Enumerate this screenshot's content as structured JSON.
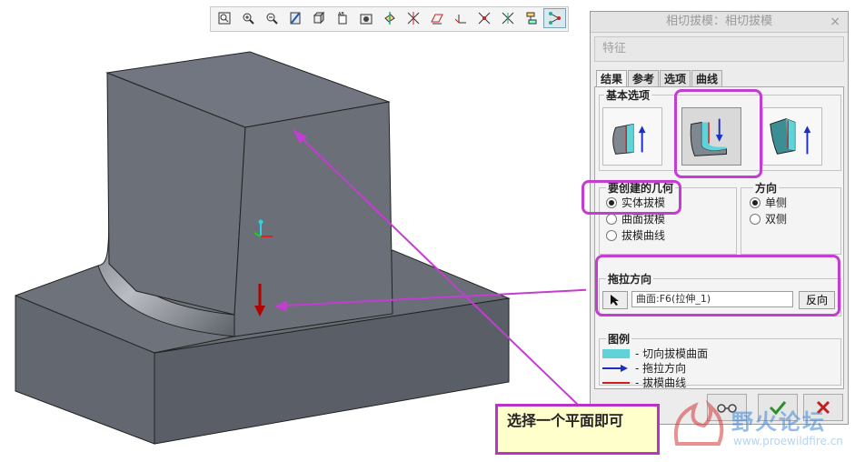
{
  "toolbar": {
    "buttons": [
      {
        "icon": "zoom-refit-icon"
      },
      {
        "icon": "zoom-in-icon"
      },
      {
        "icon": "zoom-out-icon"
      },
      {
        "icon": "repaint-icon"
      },
      {
        "icon": "orientation-icon"
      },
      {
        "icon": "saved-views-icon"
      },
      {
        "icon": "display-style-icon"
      },
      {
        "icon": "datum-planes-icon"
      },
      {
        "icon": "datum-axes-icon"
      },
      {
        "icon": "datum-points-icon"
      },
      {
        "icon": "coordinate-systems-icon"
      },
      {
        "icon": "annotations-icon"
      },
      {
        "icon": "spin-center-icon"
      },
      {
        "icon": "model-tree-icon"
      },
      {
        "icon": "selection-filter-icon"
      }
    ]
  },
  "dialog": {
    "title": "相切拔模：相切拔模",
    "close_label": "×",
    "feature_label": "特征",
    "tabs": [
      "结果",
      "参考",
      "选项",
      "曲线"
    ],
    "basic_options": {
      "title": "基本选项",
      "buttons": [
        {
          "icon": "tangent-draft-curve-option-icon"
        },
        {
          "icon": "tangent-draft-solid-option-icon"
        },
        {
          "icon": "tangent-draft-surface-option-icon"
        }
      ]
    },
    "geometry": {
      "title": "要创建的几何",
      "options": [
        {
          "label": "实体拔模",
          "selected": true
        },
        {
          "label": "曲面拔模",
          "selected": false
        },
        {
          "label": "拔模曲线",
          "selected": false
        }
      ]
    },
    "direction": {
      "title": "方向",
      "options": [
        {
          "label": "单侧",
          "selected": true
        },
        {
          "label": "双侧",
          "selected": false
        }
      ]
    },
    "pull_direction": {
      "title": "拖拉方向",
      "field_value": "曲面:F6(拉伸_1)",
      "reverse_label": "反向"
    },
    "legend": {
      "title": "图例",
      "items": [
        {
          "label": "- 切向拔模曲面",
          "color": "#5fd3d8"
        },
        {
          "label": "- 拖拉方向",
          "color": "#1a2fc4"
        },
        {
          "label": "- 拔模曲线",
          "color": "#d11e1e"
        }
      ]
    }
  },
  "callout": {
    "text": "选择一个平面即可"
  },
  "watermark": {
    "title": "野火论坛",
    "url": "www.proewildfire.cn"
  },
  "colors": {
    "highlight": "#c43dd2",
    "model_face": "#6b7079",
    "callout_bg": "#ffffcc"
  }
}
